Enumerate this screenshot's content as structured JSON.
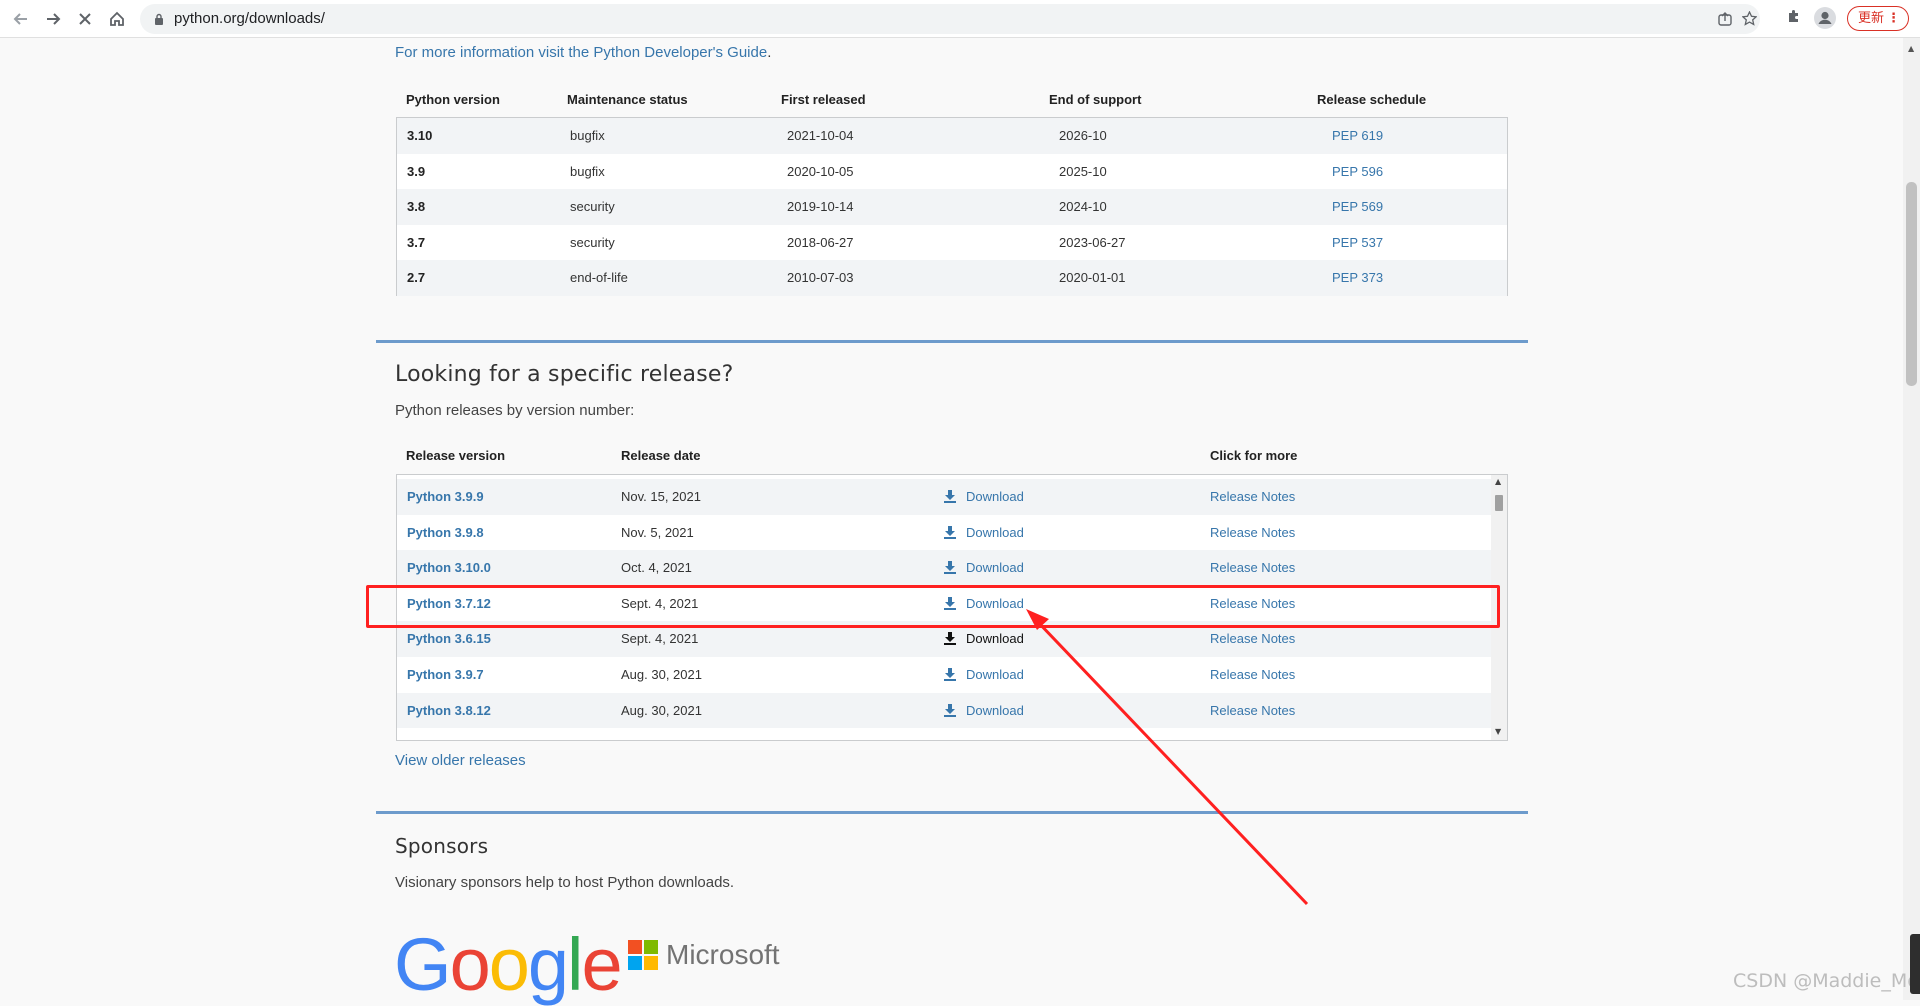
{
  "browser": {
    "url": "python.org/downloads/",
    "update_label": "更新",
    "update_more": "⋮"
  },
  "intro": {
    "link_text": "For more information visit the Python Developer's Guide",
    "period": "."
  },
  "maintenance": {
    "headers": [
      "Python version",
      "Maintenance status",
      "First released",
      "End of support",
      "Release schedule"
    ],
    "rows": [
      {
        "version": "3.10",
        "status": "bugfix",
        "first": "2021-10-04",
        "end": "2026-10",
        "pep": "PEP 619"
      },
      {
        "version": "3.9",
        "status": "bugfix",
        "first": "2020-10-05",
        "end": "2025-10",
        "pep": "PEP 596"
      },
      {
        "version": "3.8",
        "status": "security",
        "first": "2019-10-14",
        "end": "2024-10",
        "pep": "PEP 569"
      },
      {
        "version": "3.7",
        "status": "security",
        "first": "2018-06-27",
        "end": "2023-06-27",
        "pep": "PEP 537"
      },
      {
        "version": "2.7",
        "status": "end-of-life",
        "first": "2010-07-03",
        "end": "2020-01-01",
        "pep": "PEP 373"
      }
    ]
  },
  "releases": {
    "title": "Looking for a specific release?",
    "subtitle": "Python releases by version number:",
    "headers": [
      "Release version",
      "Release date",
      "Click for more"
    ],
    "rows": [
      {
        "version": "Python 3.9.9",
        "date": "Nov. 15, 2021",
        "download": "Download",
        "notes": "Release Notes"
      },
      {
        "version": "Python 3.9.8",
        "date": "Nov. 5, 2021",
        "download": "Download",
        "notes": "Release Notes"
      },
      {
        "version": "Python 3.10.0",
        "date": "Oct. 4, 2021",
        "download": "Download",
        "notes": "Release Notes"
      },
      {
        "version": "Python 3.7.12",
        "date": "Sept. 4, 2021",
        "download": "Download",
        "notes": "Release Notes"
      },
      {
        "version": "Python 3.6.15",
        "date": "Sept. 4, 2021",
        "download": "Download",
        "notes": "Release Notes"
      },
      {
        "version": "Python 3.9.7",
        "date": "Aug. 30, 2021",
        "download": "Download",
        "notes": "Release Notes"
      },
      {
        "version": "Python 3.8.12",
        "date": "Aug. 30, 2021",
        "download": "Download",
        "notes": "Release Notes"
      }
    ],
    "older_link": "View older releases"
  },
  "sponsors": {
    "title": "Sponsors",
    "subtitle": "Visionary sponsors help to host Python downloads.",
    "microsoft": "Microsoft",
    "google": "Google"
  },
  "watermark": "CSDN @Maddie_Mo",
  "colors": {
    "link": "#3776ab",
    "rule": "#6d9bcc",
    "annotation": "#ff2020"
  }
}
